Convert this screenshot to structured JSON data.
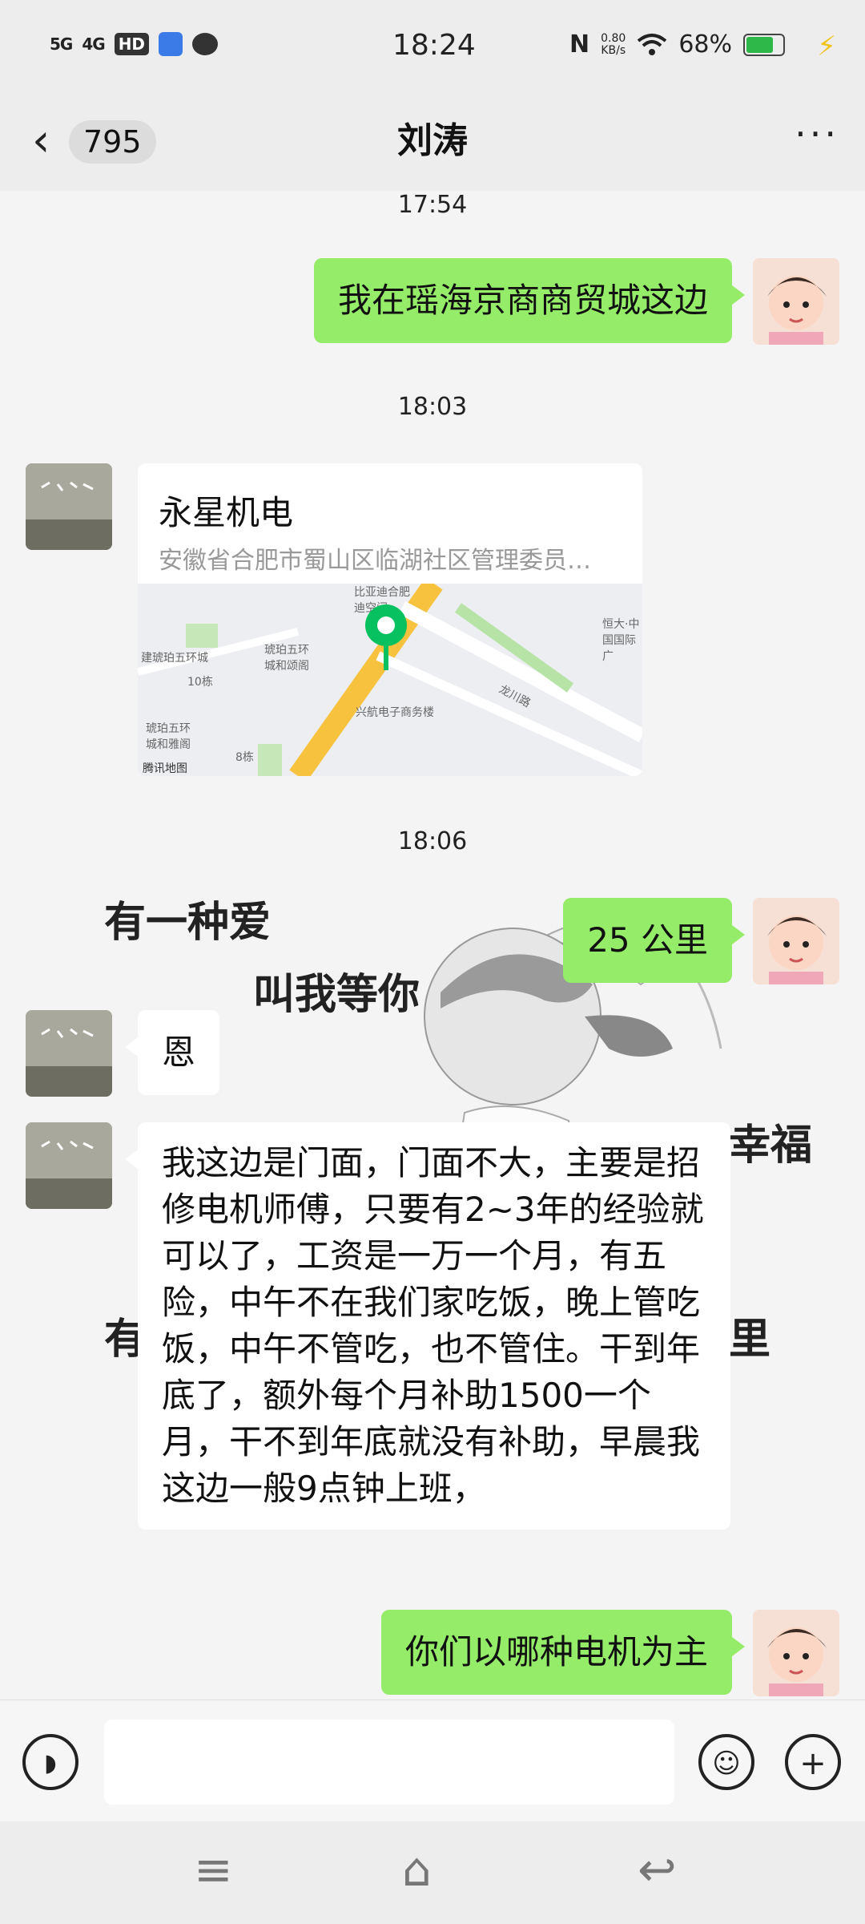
{
  "status_bar": {
    "net1": "5G",
    "net2": "4G",
    "hd": "HD",
    "time": "18:24",
    "nfc": "N",
    "speed_value": "0.80",
    "speed_unit": "KB/s",
    "battery": "68%",
    "battery_level": 0.68
  },
  "header": {
    "back_count": "795",
    "title": "刘涛",
    "more": "···"
  },
  "chat": {
    "times": [
      "17:54",
      "18:03",
      "18:06"
    ],
    "messages": {
      "m1": "我在瑶海京商商贸城这边",
      "m2": "25 公里",
      "m3": "恩",
      "m4": "我这边是门面，门面不大，主要是招修电机师傅，只要有2~3年的经验就可以了，工资是一万一个月，有五险，中午不在我们家吃饭，晚上管吃饭，中午不管吃，也不管住。干到年底了，额外每个月补助1500一个月，干不到年底就没有补助，早晨我这边一般9点钟上班，",
      "m5": "你们以哪种电机为主"
    },
    "location": {
      "name": "永星机电",
      "address": "安徽省合肥市蜀山区临湖社区管理委员…",
      "map_labels": [
        "比亚迪合肥迪空间",
        "琥珀五环城和颂阁",
        "建琥珀五环城",
        "10栋",
        "琥珀五环城和雅阁",
        "8栋",
        "兴航电子商务楼",
        "龙川路",
        "恒大·中国国际广",
        "腾讯地图"
      ]
    },
    "sticker_text": [
      "有一种爱",
      "叫我等你",
      "幸福",
      "有",
      "里"
    ]
  },
  "colors": {
    "me_bubble": "#95ec69",
    "them_bubble": "#ffffff",
    "background": "#f4f4f4"
  }
}
